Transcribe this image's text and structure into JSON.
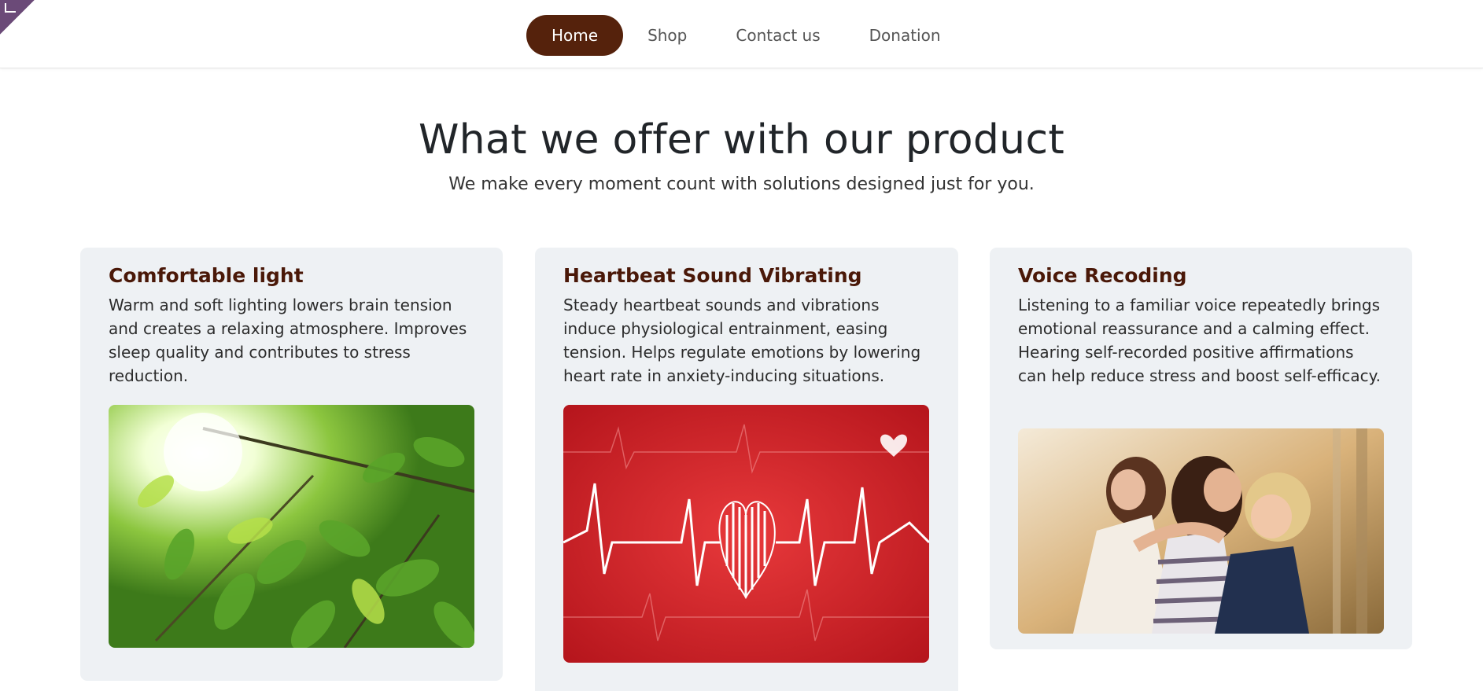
{
  "nav": {
    "items": [
      {
        "label": "Home",
        "active": true
      },
      {
        "label": "Shop",
        "active": false
      },
      {
        "label": "Contact us",
        "active": false
      },
      {
        "label": "Donation",
        "active": false
      }
    ]
  },
  "hero": {
    "title": "What we offer with our product",
    "subtitle": "We make every moment count with solutions designed just for you."
  },
  "cards": [
    {
      "title": "Comfortable light",
      "description": "Warm and soft lighting lowers brain tension and creates a relaxing atmosphere. Improves sleep quality and contributes to stress reduction.",
      "image": "sunlight-through-green-leaves"
    },
    {
      "title": "Heartbeat Sound Vibrating",
      "description": "Steady heartbeat sounds and vibrations induce physiological entrainment, easing tension. Helps regulate emotions by lowering heart rate in anxiety-inducing situations.",
      "image": "red-heartbeat-ekg-heart"
    },
    {
      "title": "Voice Recoding",
      "description": "Listening to a familiar voice repeatedly brings emotional reassurance and a calming effect. Hearing self-recorded positive affirmations can help reduce stress and boost self-efficacy.",
      "image": "mother-hugging-children"
    }
  ],
  "colors": {
    "brand": "#55220c",
    "card_title": "#4a1808",
    "card_bg": "#eef1f4",
    "corner_badge": "#6b4a78"
  }
}
